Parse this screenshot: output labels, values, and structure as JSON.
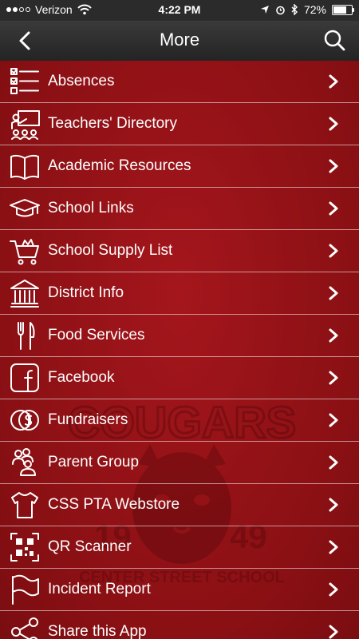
{
  "status": {
    "carrier": "Verizon",
    "time": "4:22 PM",
    "battery": "72%",
    "battery_level": 0.72
  },
  "nav": {
    "title": "More"
  },
  "menu": [
    {
      "label": "Absences",
      "icon": "checklist-icon"
    },
    {
      "label": "Teachers' Directory",
      "icon": "teacher-icon"
    },
    {
      "label": "Academic Resources",
      "icon": "book-icon"
    },
    {
      "label": "School Links",
      "icon": "graduation-cap-icon"
    },
    {
      "label": "School Supply List",
      "icon": "shopping-cart-icon"
    },
    {
      "label": "District Info",
      "icon": "building-icon"
    },
    {
      "label": "Food Services",
      "icon": "fork-knife-icon"
    },
    {
      "label": "Facebook",
      "icon": "facebook-icon"
    },
    {
      "label": "Fundraisers",
      "icon": "coins-icon"
    },
    {
      "label": "Parent Group",
      "icon": "people-icon"
    },
    {
      "label": "CSS PTA Webstore",
      "icon": "tshirt-icon"
    },
    {
      "label": "QR Scanner",
      "icon": "qr-code-icon"
    },
    {
      "label": "Incident Report",
      "icon": "flag-icon"
    },
    {
      "label": "Share this App",
      "icon": "share-icon"
    }
  ],
  "watermark": {
    "top": "COUGARS",
    "year_left": "19",
    "year_right": "49",
    "bottom": "CENTER STREET SCHOOL"
  },
  "colors": {
    "background": "#8e1216",
    "navbar": "#2b2b2b",
    "text": "#ffffff"
  }
}
